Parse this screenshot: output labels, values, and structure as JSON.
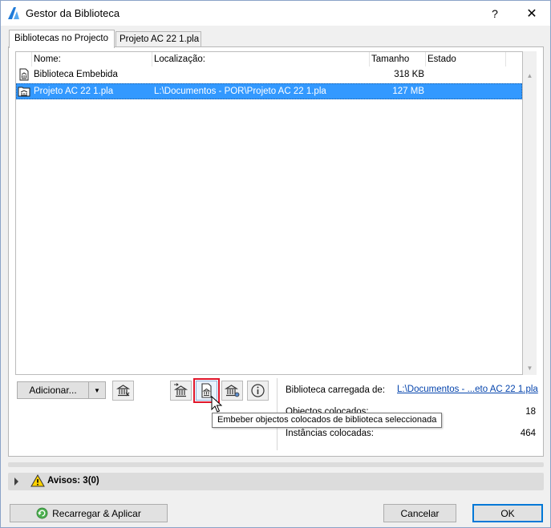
{
  "window": {
    "title": "Gestor da Biblioteca",
    "help_label": "?",
    "close_label": "✕"
  },
  "tabs": [
    {
      "label": "Bibliotecas no Projecto",
      "active": true
    },
    {
      "label": "Projeto AC 22 1.pla",
      "active": false
    }
  ],
  "table": {
    "columns": [
      "Nome:",
      "Localização:",
      "Tamanho",
      "Estado"
    ],
    "rows": [
      {
        "name": "Biblioteca Embebida",
        "location": "",
        "size": "318 KB",
        "status": "",
        "icon": "embedded-library-icon",
        "selected": false
      },
      {
        "name": "Projeto AC 22 1.pla",
        "location": "L:\\Documentos - POR\\Projeto AC 22 1.pla",
        "size": "127 MB",
        "status": "",
        "icon": "library-folder-icon",
        "selected": true
      }
    ]
  },
  "toolbar": {
    "add_label": "Adicionar...",
    "dropdown_arrow": "▼"
  },
  "tooltip": {
    "text": "Embeber objectos colocados de biblioteca seleccionada"
  },
  "info": {
    "loaded_library_label": "Biblioteca carregada de:",
    "loaded_library_value": "L:\\Documentos - ...eto AC 22 1.pla",
    "placed_objects_label": "Objectos colocados:",
    "placed_objects_value": "18",
    "placed_instances_label": "Instâncias colocadas:",
    "placed_instances_value": "464"
  },
  "warnings": {
    "label": "Avisos: 3(0)"
  },
  "footer": {
    "reload_label": "Recarregar & Aplicar",
    "cancel_label": "Cancelar",
    "ok_label": "OK"
  },
  "colors": {
    "selection": "#3399ff",
    "highlight_outline": "#e0162b",
    "link": "#0645ad"
  }
}
